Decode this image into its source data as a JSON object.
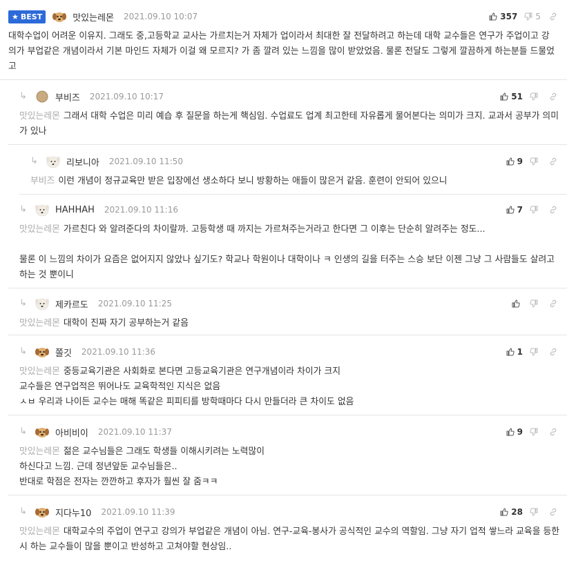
{
  "best_label": "BEST",
  "comments": [
    {
      "nick": "맛있는레몬",
      "date": "2021.09.10 10:07",
      "up": "357",
      "down": "5",
      "mention": "",
      "lines": [
        "대학수업이 어려운 이유지. 그래도 중,고등학교 교사는 가르치는거 자체가 업이라서 최대한 잘 전달하려고 하는데 대학 교수들은 연구가 주업이고 강의가 부업같은 개념이라서 기본 마인드 자체가 이걸 왜 모르지? 가 좀 깔려 있는 느낌을 많이 받았었음. 물론 전달도 그렇게 깔끔하게 하는분들 드물었고"
      ]
    },
    {
      "nick": "부비즈",
      "date": "2021.09.10 10:17",
      "up": "51",
      "down": "",
      "mention": "맛있는레몬",
      "lines": [
        "그래서 대학 수업은 미리 예습 후 질문을 하는게 핵심임. 수업료도 업계 최고한테 자유롭게 물어본다는 의미가 크지. 교과서 공부가 의미가 있나"
      ]
    },
    {
      "nick": "리보니아",
      "date": "2021.09.10 11:50",
      "up": "9",
      "down": "",
      "mention": "부비즈",
      "lines": [
        "이런 개념이 정규교육만 받은 입장에선 생소하다 보니 방황하는 애들이 많은거 같음. 훈련이 안되어 있으니"
      ]
    },
    {
      "nick": "HAHHAH",
      "date": "2021.09.10 11:16",
      "up": "7",
      "down": "",
      "mention": "맛있는레몬",
      "lines": [
        "가르친다 와 알려준다의 차이랄까. 고등학생 때 까지는 가르쳐주는거라고 한다면 그 이후는 단순히 알려주는 정도...",
        "",
        "물론 이 느낌의 차이가 요즘은 없어지지 않았나 싶기도? 학교나 학원이나 대학이나 ㅋ 인생의 길을 터주는 스승 보단 이젠 그냥 그 사람들도 살려고 하는 것 뿐이니"
      ]
    },
    {
      "nick": "제카르도",
      "date": "2021.09.10 11:25",
      "up": "",
      "down": "",
      "mention": "맛있는레몬",
      "lines": [
        "대학이 진짜 자기 공부하는거 같음"
      ]
    },
    {
      "nick": "쫄깃",
      "date": "2021.09.10 11:36",
      "up": "1",
      "down": "",
      "mention": "맛있는레몬",
      "lines": [
        "중등교육기관은 사회화로 본다면 고등교육기관은 연구개념이라 차이가 크지",
        "교수들은 연구업적은 뛰어나도 교육학적인 지식은 없음",
        "ㅅㅂ 우리과 나이든 교수는 매해 똑같은 피피티를 방학때마다 다시 만들더라 큰 차이도 없음"
      ]
    },
    {
      "nick": "아비비이",
      "date": "2021.09.10 11:37",
      "up": "9",
      "down": "",
      "mention": "맛있는레몬",
      "lines": [
        "젊은 교수님들은 그래도 학생들 이해시키려는 노력많이",
        "하신다고 느낌. 근데 정년앞둔 교수님들은..",
        "반대로 학점은 전자는 깐깐하고 후자가 훨씬 잘 줌ㅋㅋ"
      ]
    },
    {
      "nick": "지다누10",
      "date": "2021.09.10 11:39",
      "up": "28",
      "down": "",
      "mention": "맛있는레몬",
      "lines": [
        "대학교수의 주업이 연구고 강의가 부업같은 개념이 아님. 연구-교육-봉사가 공식적인 교수의 역할임. 그냥 자기 업적 쌓느라 교육을 등한시 하는 교수들이 많을 뿐이고 반성하고 고쳐야할 현상임.."
      ]
    }
  ]
}
